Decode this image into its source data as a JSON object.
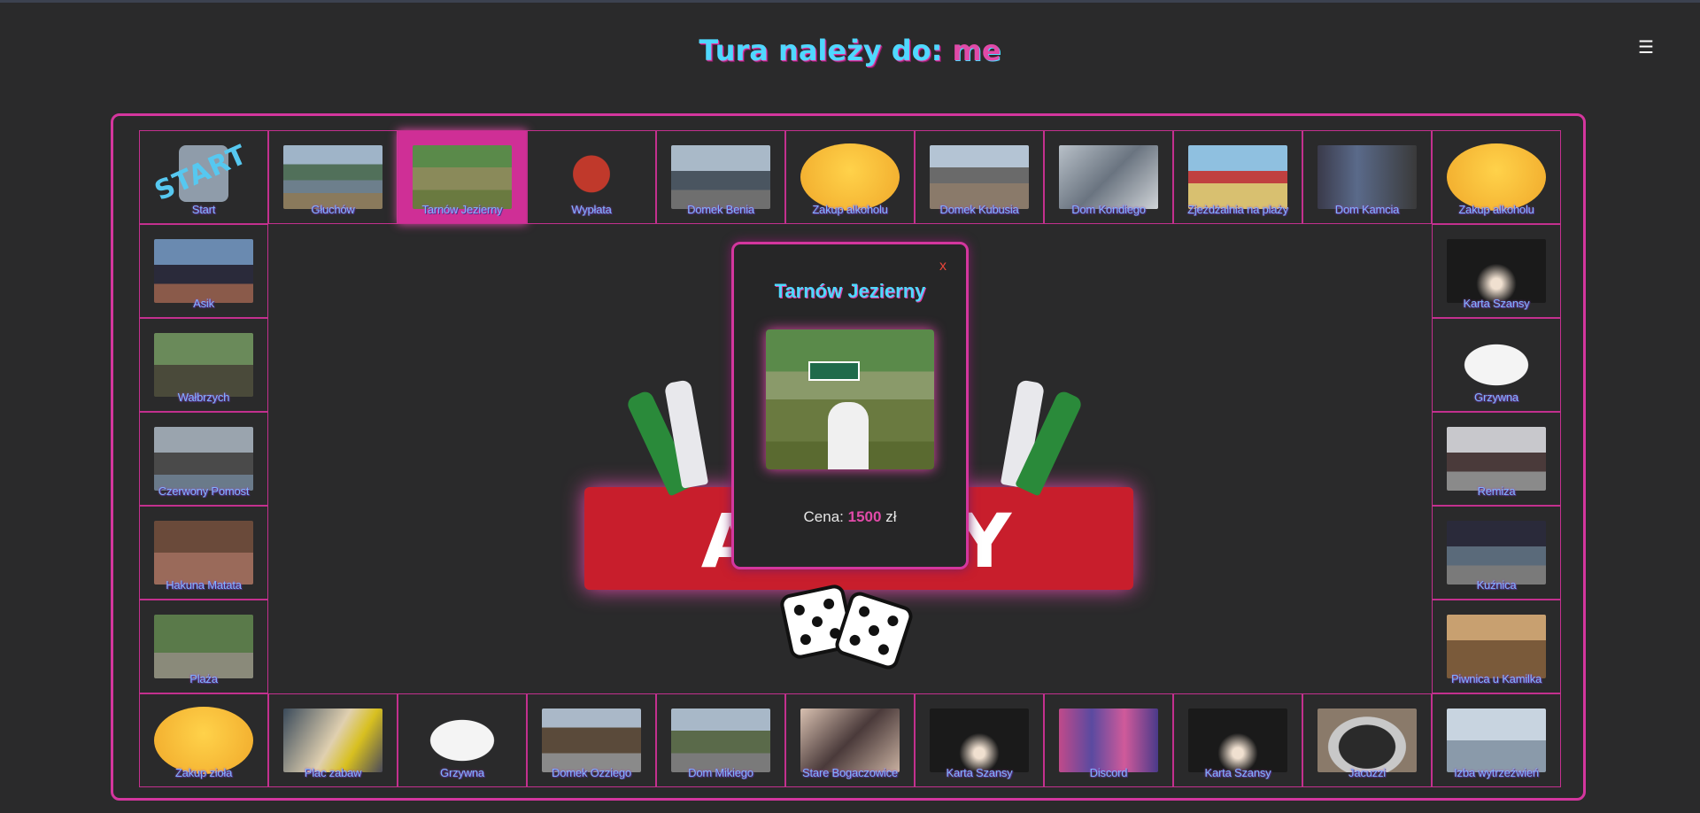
{
  "header": {
    "turn_label": "Tura należy do:",
    "turn_player": "me",
    "menu_icon": "hamburger-icon"
  },
  "board": {
    "start": {
      "text": "START",
      "label": "Start"
    },
    "top": [
      "Głuchów",
      "Tarnów Jezierny",
      "Wypłata",
      "Domek Benia",
      "Zakup alkoholu",
      "Domek Kubusia",
      "Dom Kondiego",
      "Zjeżdżalnia na plaży",
      "Dom Kamcia",
      "Zakup alkoholu"
    ],
    "left": [
      "Asik",
      "Wałbrzych",
      "Czerwony Pomost",
      "Hakuna Matata",
      "Plaża"
    ],
    "right": [
      "Karta Szansy",
      "Grzywna",
      "Remiza",
      "Kuźnica",
      "Piwnica u Kamilka"
    ],
    "bottom": [
      "Zakup zioła",
      "Plac zabaw",
      "Grzywna",
      "Domek Ozziego",
      "Dom Mikiego",
      "Stare Bogaczowice",
      "Karta Szansy",
      "Discord",
      "Karta Szansy",
      "Jacuzzi",
      "Izba wytrzeźwień"
    ],
    "active_field": "Tarnów Jezierny",
    "center_logo": "AL    OLY"
  },
  "popup": {
    "close": "x",
    "title": "Tarnów Jezierny",
    "price_label": "Cena:",
    "price_value": "1500",
    "currency": "zł"
  },
  "colors": {
    "accent": "#d4369e",
    "cyan": "#4fd8ff",
    "background": "#2a2a2b",
    "label": "#7fb5ff"
  }
}
